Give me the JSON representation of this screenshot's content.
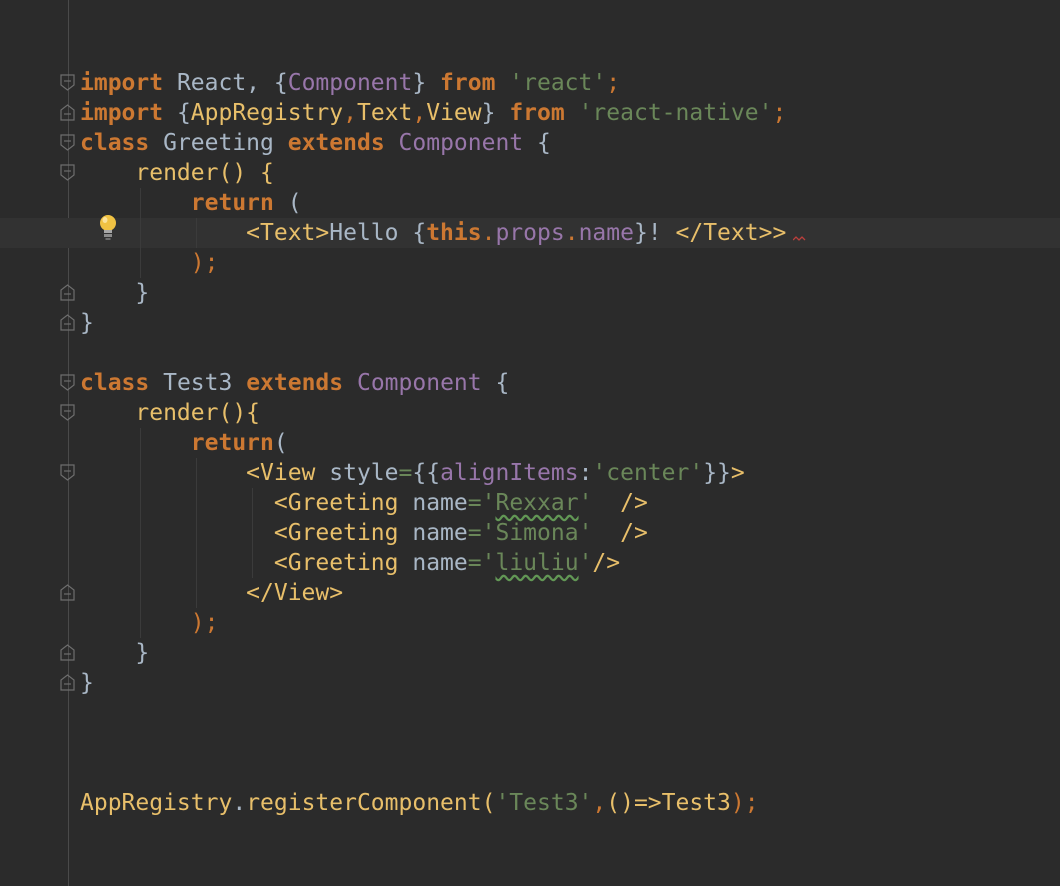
{
  "editor": {
    "colors": {
      "background": "#2b2b2b",
      "keyword": "#cc7832",
      "string": "#6a8759",
      "field": "#9876aa",
      "tag": "#e8bf6a",
      "text": "#a9b7c6"
    },
    "lines": {
      "l1": {
        "t1": "import",
        "t2": " React, {",
        "t3": "Component",
        "t4": "} ",
        "t5": "from",
        "t6": " ",
        "t7": "'react'",
        "t8": ";"
      },
      "l2": {
        "t1": "import",
        "t2": " {",
        "t3": "AppRegistry",
        "t4": ",",
        "t5": "Text",
        "t6": ",",
        "t7": "View",
        "t8": "} ",
        "t9": "from",
        "t10": " ",
        "t11": "'react-native'",
        "t12": ";"
      },
      "l3": {
        "t1": "class",
        "t2": " Greeting ",
        "t3": "extends",
        "t4": " ",
        "t5": "Component",
        "t6": " {"
      },
      "l4": {
        "t1": "    render() {"
      },
      "l5": {
        "t1": "        ",
        "t2": "return",
        "t3": " ("
      },
      "l6": {
        "t1": "            ",
        "t2": "<Text>",
        "t3": "Hello {",
        "t4": "this",
        "t5": ".",
        "t6": "props",
        "t7": ".",
        "t8": "name",
        "t9": "}! ",
        "t10": "</Text>",
        "t11": ">"
      },
      "l7": {
        "t1": "        ",
        "t2": ");"
      },
      "l8": {
        "t1": "    }"
      },
      "l9": {
        "t1": "}"
      },
      "l10": {
        "t1": "class",
        "t2": " Test3 ",
        "t3": "extends",
        "t4": " ",
        "t5": "Component",
        "t6": " {"
      },
      "l11": {
        "t1": "    render(){"
      },
      "l12": {
        "t1": "        ",
        "t2": "return",
        "t3": "("
      },
      "l13": {
        "t1": "            ",
        "t2": "<View",
        "t3": " style",
        "t4": "=",
        "t5": "{{",
        "t6": "alignItems",
        "t7": ":",
        "t8": "'center'",
        "t9": "}}",
        "t10": ">"
      },
      "l14": {
        "t1": "              ",
        "t2": "<Greeting",
        "t3": " name",
        "t4": "=",
        "t5": "'",
        "t6": "Rexxar",
        "t7": "'",
        "t8": "  ",
        "t9": "/>"
      },
      "l15": {
        "t1": "              ",
        "t2": "<Greeting",
        "t3": " name",
        "t4": "=",
        "t5": "'",
        "t6": "Simona",
        "t7": "'",
        "t8": "  ",
        "t9": "/>"
      },
      "l16": {
        "t1": "              ",
        "t2": "<Greeting",
        "t3": " name",
        "t4": "=",
        "t5": "'",
        "t6": "liuliu",
        "t7": "'",
        "t8": "/>"
      },
      "l17": {
        "t1": "            ",
        "t2": "</View>"
      },
      "l18": {
        "t1": "        ",
        "t2": ");"
      },
      "l19": {
        "t1": "    }"
      },
      "l20": {
        "t1": "}"
      },
      "l21": {
        "t1": "AppRegistry",
        "t2": ".",
        "t3": "registerComponent",
        "t4": "(",
        "t5": "'Test3'",
        "t6": ",",
        "t7": "()=>",
        "t8": "Test3",
        "t9": ");"
      }
    }
  }
}
